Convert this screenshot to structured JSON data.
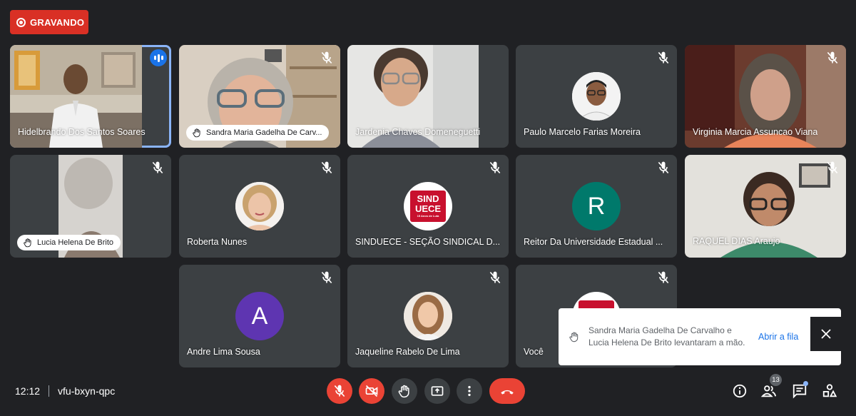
{
  "recording": {
    "label": "GRAVANDO"
  },
  "participants": [
    {
      "name": "Hidelbrando Dos Santos Soares"
    },
    {
      "name": "Sandra Maria Gadelha De Carv..."
    },
    {
      "name": "Jardenia Chaves Domeneguetti"
    },
    {
      "name": "Paulo Marcelo Farias Moreira"
    },
    {
      "name": "Virginia Marcia Assuncao Viana"
    },
    {
      "name": "Lucia Helena De Brito"
    },
    {
      "name": "Roberta Nunes"
    },
    {
      "name": "SINDUECE - SEÇÃO SINDICAL D..."
    },
    {
      "name": "Reitor Da Universidade Estadual ..."
    },
    {
      "name": "RAQUEL DIAS Araujo"
    },
    {
      "name": "Andre Lima Sousa"
    },
    {
      "name": "Jaqueline Rabelo De Lima"
    },
    {
      "name": "Você"
    }
  ],
  "avatars": {
    "reitor_letter": "R",
    "andre_letter": "A",
    "sind_logo_text_top": "SIND",
    "sind_logo_text_bottom": "UECE",
    "sind_logo_sub": "15 Anos de Luta"
  },
  "colors": {
    "recording": "#d93025",
    "speaking": "#8ab4f8",
    "reitor_avatar": "#00796b",
    "andre_avatar": "#5e35b1",
    "end_call": "#ea4335"
  },
  "toast": {
    "message": "Sandra Maria Gadelha De Carvalho e Lucia Helena De Brito levantaram a mão.",
    "action": "Abrir a fila"
  },
  "meeting": {
    "time": "12:12",
    "code": "vfu-bxyn-qpc"
  },
  "people_count": "13",
  "icons": [
    "mic-off-icon",
    "camera-off-icon",
    "raise-hand-icon",
    "present-screen-icon",
    "more-options-icon",
    "end-call-icon",
    "info-icon",
    "people-icon",
    "chat-icon",
    "activities-icon",
    "close-icon"
  ]
}
